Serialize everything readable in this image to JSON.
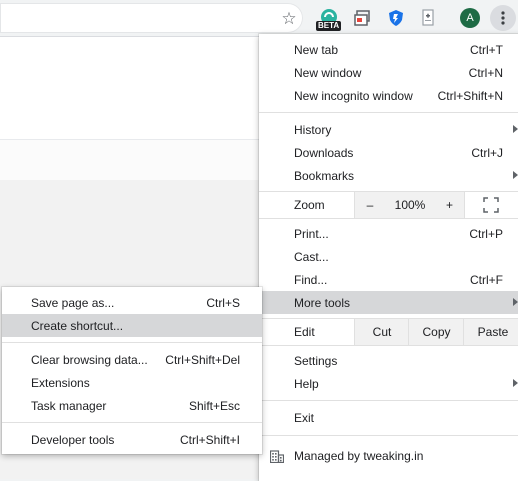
{
  "toolbar": {
    "star_icon": "star-icon",
    "beta_badge": "BETA",
    "avatar_letter": "A"
  },
  "menu": {
    "new_tab": {
      "label": "New tab",
      "shortcut": "Ctrl+T"
    },
    "new_window": {
      "label": "New window",
      "shortcut": "Ctrl+N"
    },
    "new_incognito": {
      "label": "New incognito window",
      "shortcut": "Ctrl+Shift+N"
    },
    "history": {
      "label": "History"
    },
    "downloads": {
      "label": "Downloads",
      "shortcut": "Ctrl+J"
    },
    "bookmarks": {
      "label": "Bookmarks"
    },
    "zoom": {
      "label": "Zoom",
      "minus": "–",
      "value": "100%",
      "plus": "+"
    },
    "print": {
      "label": "Print...",
      "shortcut": "Ctrl+P"
    },
    "cast": {
      "label": "Cast..."
    },
    "find": {
      "label": "Find...",
      "shortcut": "Ctrl+F"
    },
    "more_tools": {
      "label": "More tools"
    },
    "edit": {
      "label": "Edit",
      "cut": "Cut",
      "copy": "Copy",
      "paste": "Paste"
    },
    "settings": {
      "label": "Settings"
    },
    "help": {
      "label": "Help"
    },
    "exit": {
      "label": "Exit"
    },
    "managed": {
      "label": "Managed by tweaking.in"
    }
  },
  "submenu": {
    "save_page": {
      "label": "Save page as...",
      "shortcut": "Ctrl+S"
    },
    "create_shortcut": {
      "label": "Create shortcut..."
    },
    "clear_data": {
      "label": "Clear browsing data...",
      "shortcut": "Ctrl+Shift+Del"
    },
    "extensions": {
      "label": "Extensions"
    },
    "task_manager": {
      "label": "Task manager",
      "shortcut": "Shift+Esc"
    },
    "dev_tools": {
      "label": "Developer tools",
      "shortcut": "Ctrl+Shift+I"
    }
  },
  "colors": {
    "highlight": "#d6d7d9",
    "avatar": "#1e6b45",
    "extension_teal": "#2bb3a0",
    "extension_blue": "#1a73e8"
  }
}
